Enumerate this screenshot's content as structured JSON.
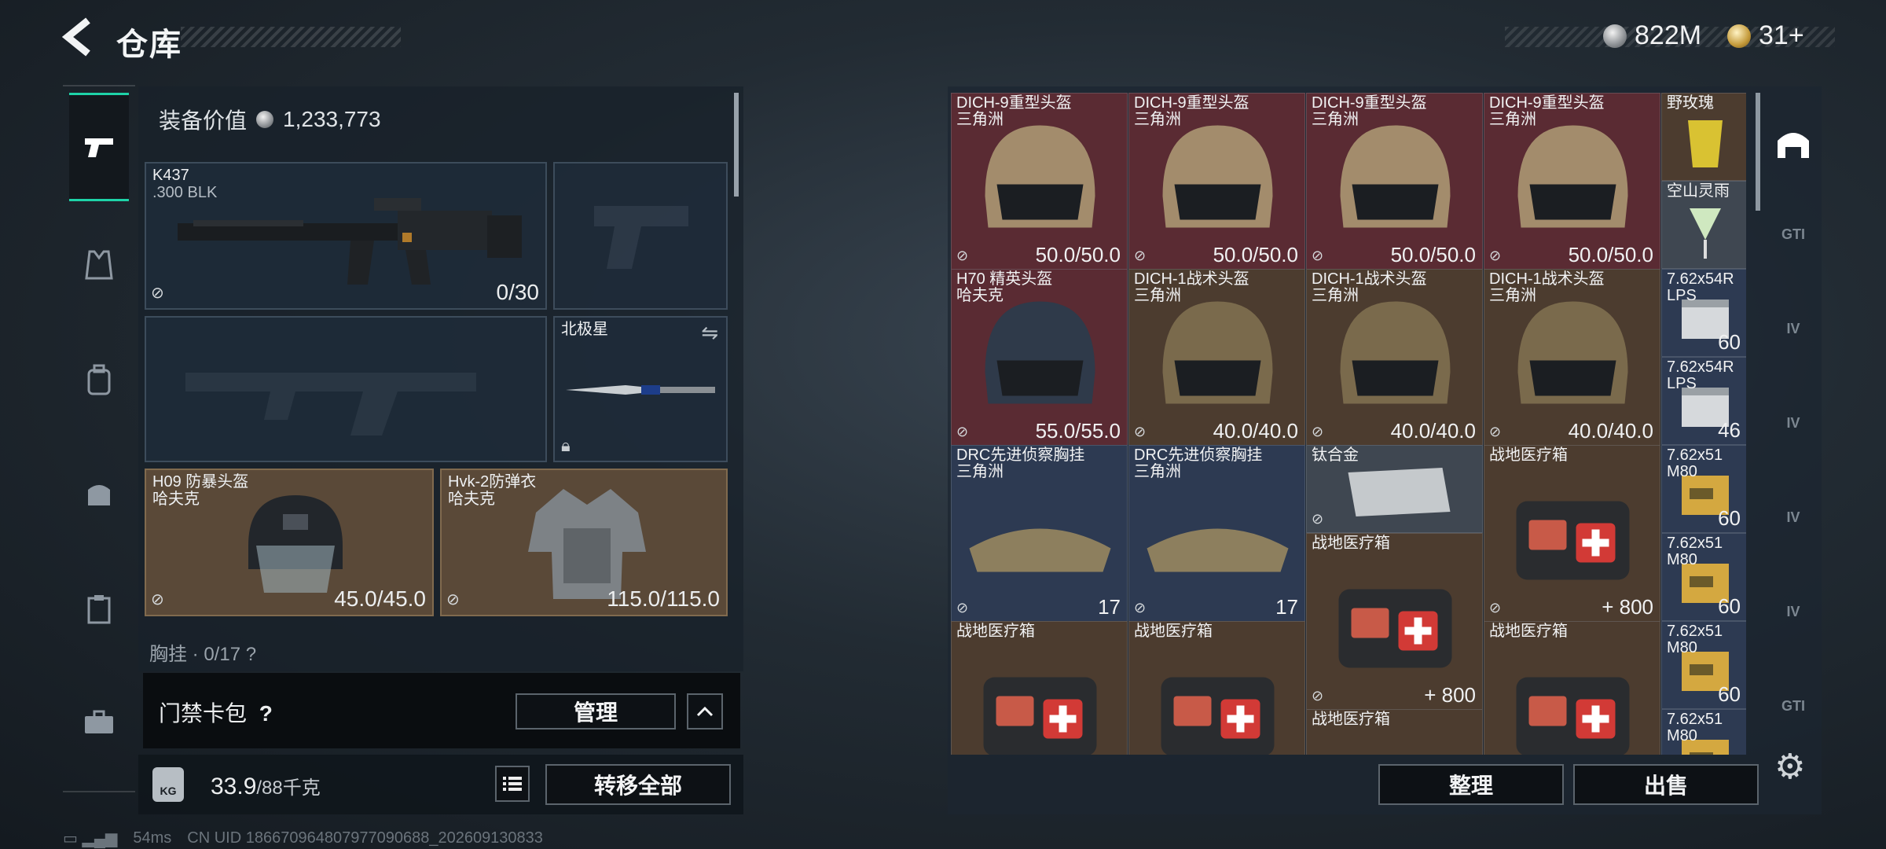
{
  "header": {
    "title": "仓库",
    "silver": "822M",
    "gold": "31+"
  },
  "loadout": {
    "value_label": "装备价值",
    "value": "1,233,773",
    "primary": {
      "name": "K437",
      "caliber": ".300 BLK",
      "ammo": "0/30"
    },
    "melee": {
      "name": "北极星"
    },
    "helmet": {
      "name": "H09 防暴头盔",
      "maker": "哈夫克",
      "durability": "45.0/45.0"
    },
    "armor": {
      "name": "Hvk-2防弹衣",
      "maker": "哈夫克",
      "durability": "115.0/115.0"
    },
    "chest_rig_partial": "胸挂 · 0/17 ?",
    "card_pack": "门禁卡包",
    "help": "?",
    "manage": "管理",
    "weight": "33.9",
    "weight_max": "/88千克",
    "weight_badge": "KG",
    "transfer_all": "转移全部"
  },
  "status": {
    "ping": "54ms",
    "uid": "CN UID 1866709648079770906​88_202609130833"
  },
  "stash": {
    "sort": "整理",
    "sell": "出售",
    "cells": [
      {
        "name": "DICH-9重型头盔",
        "maker": "三角洲",
        "value": "50.0/50.0"
      },
      {
        "name": "DICH-9重型头盔",
        "maker": "三角洲",
        "value": "50.0/50.0"
      },
      {
        "name": "DICH-9重型头盔",
        "maker": "三角洲",
        "value": "50.0/50.0"
      },
      {
        "name": "DICH-9重型头盔",
        "maker": "三角洲",
        "value": "50.0/50.0"
      },
      {
        "name": "野玫瑰",
        "maker": "",
        "value": ""
      },
      {
        "name": "空山灵雨",
        "maker": "",
        "value": ""
      },
      {
        "name": "H70 精英头盔",
        "maker": "哈夫克",
        "value": "55.0/55.0"
      },
      {
        "name": "DICH-1战术头盔",
        "maker": "三角洲",
        "value": "40.0/40.0"
      },
      {
        "name": "DICH-1战术头盔",
        "maker": "三角洲",
        "value": "40.0/40.0"
      },
      {
        "name": "DICH-1战术头盔",
        "maker": "三角洲",
        "value": "40.0/40.0"
      },
      {
        "name": "7.62x54R",
        "maker": "LPS",
        "value": "60"
      },
      {
        "name": "7.62x54R",
        "maker": "LPS",
        "value": "46"
      },
      {
        "name": "DRC先进侦察胸挂",
        "maker": "三角洲",
        "value": "17"
      },
      {
        "name": "DRC先进侦察胸挂",
        "maker": "三角洲",
        "value": "17"
      },
      {
        "name": "钛合金",
        "maker": "",
        "value": ""
      },
      {
        "name": "战地医疗箱",
        "maker": "",
        "value": "+ 800"
      },
      {
        "name": "7.62x51",
        "maker": "M80",
        "value": "60"
      },
      {
        "name": "战地医疗箱",
        "maker": "",
        "value": "+ 800"
      },
      {
        "name": "7.62x51",
        "maker": "M80",
        "value": "60"
      },
      {
        "name": "战地医疗箱",
        "maker": "",
        "value": ""
      },
      {
        "name": "战地医疗箱",
        "maker": "",
        "value": ""
      },
      {
        "name": "战地医疗箱",
        "maker": "",
        "value": ""
      },
      {
        "name": "7.62x51",
        "maker": "M80",
        "value": "60"
      },
      {
        "name": "战地医疗箱",
        "maker": "",
        "value": ""
      },
      {
        "name": "7.62x51",
        "maker": "M80",
        "value": ""
      }
    ]
  },
  "side_tabs": [
    "helmet-tab",
    "gti",
    "iv",
    "iv",
    "iv",
    "iv",
    "gti"
  ]
}
